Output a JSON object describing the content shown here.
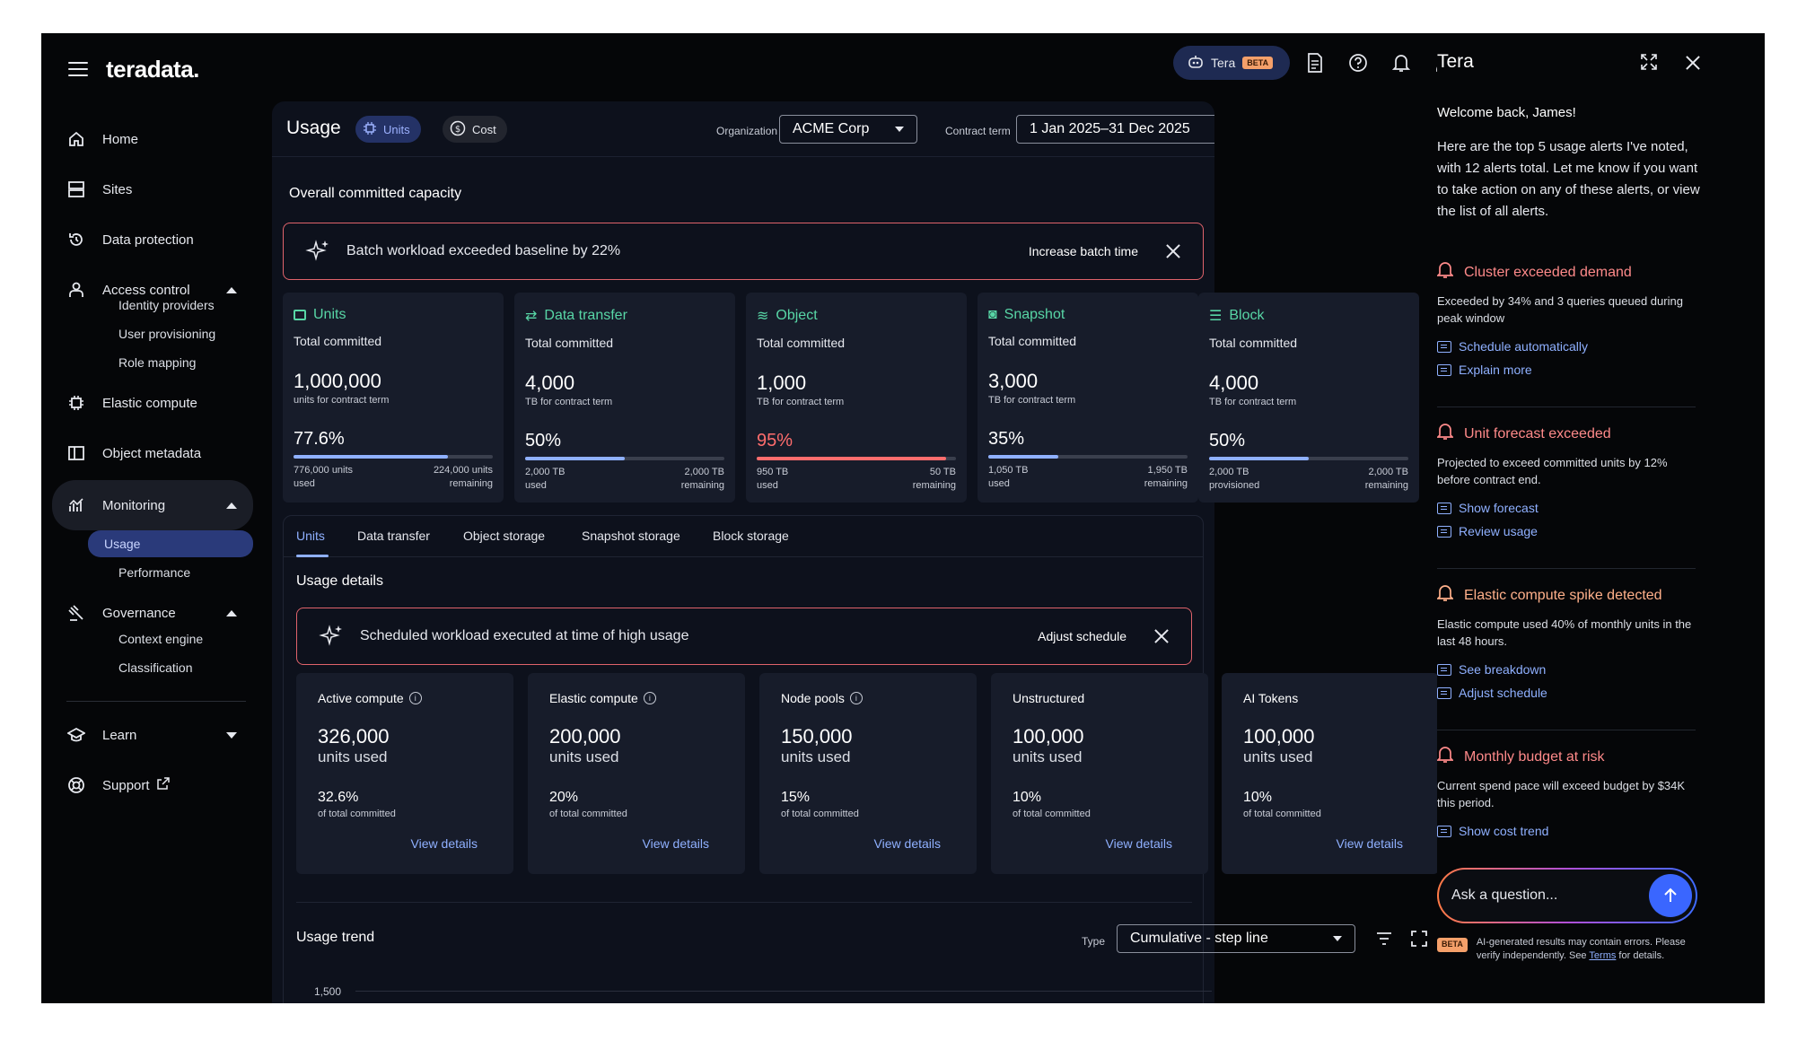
{
  "brand": {
    "logo": "teradata."
  },
  "sidebar": {
    "items": [
      {
        "id": "home",
        "label": "Home"
      },
      {
        "id": "sites",
        "label": "Sites"
      },
      {
        "id": "data-protection",
        "label": "Data protection"
      },
      {
        "id": "access-control",
        "label": "Access control"
      },
      {
        "id": "elastic-compute",
        "label": "Elastic compute"
      },
      {
        "id": "object-metadata",
        "label": "Object metadata"
      },
      {
        "id": "monitoring",
        "label": "Monitoring"
      },
      {
        "id": "governance",
        "label": "Governance"
      },
      {
        "id": "learn",
        "label": "Learn"
      },
      {
        "id": "support",
        "label": "Support"
      }
    ],
    "access_sub": [
      "Identity providers",
      "User provisioning",
      "Role mapping"
    ],
    "monitoring_sub": [
      "Usage",
      "Performance"
    ],
    "governance_sub": [
      "Context engine",
      "Classification"
    ]
  },
  "topbar": {
    "tera_label": "Tera",
    "beta_label": "BETA"
  },
  "header": {
    "title": "Usage",
    "units_label": "Units",
    "cost_label": "Cost",
    "org_label": "Organization",
    "org_value": "ACME Corp",
    "term_label": "Contract term",
    "term_value": "1 Jan 2025–31 Dec 2025"
  },
  "overall": {
    "title": "Overall committed capacity",
    "alert_msg": "Batch workload exceeded baseline by 22%",
    "alert_action": "Increase batch time"
  },
  "capacity_cards": [
    {
      "title": "Units",
      "tc": "Total committed",
      "big": "1,000,000",
      "small": "units for contract term",
      "pct": "77.6%",
      "fill": 0.776,
      "left1": "776,000 units",
      "left2": "used",
      "right1": "224,000 units",
      "right2": "remaining"
    },
    {
      "title": "Data transfer",
      "tc": "Total committed",
      "big": "4,000",
      "small": "TB for contract term",
      "pct": "50%",
      "fill": 0.5,
      "left1": "2,000 TB",
      "left2": "used",
      "right1": "2,000 TB",
      "right2": "remaining"
    },
    {
      "title": "Object",
      "tc": "Total committed",
      "big": "1,000",
      "small": "TB for contract term",
      "pct": "95%",
      "fill": 0.95,
      "left1": "950 TB",
      "left2": "used",
      "right1": "50 TB",
      "right2": "remaining"
    },
    {
      "title": "Snapshot",
      "tc": "Total committed",
      "big": "3,000",
      "small": "TB for contract term",
      "pct": "35%",
      "fill": 0.35,
      "left1": "1,050 TB",
      "left2": "used",
      "right1": "1,950 TB",
      "right2": "remaining"
    },
    {
      "title": "Block",
      "tc": "Total committed",
      "big": "4,000",
      "small": "TB for contract term",
      "pct": "50%",
      "fill": 0.5,
      "left1": "2,000 TB",
      "left2": "provisioned",
      "right1": "2,000 TB",
      "right2": "remaining"
    }
  ],
  "tabs": [
    "Units",
    "Data transfer",
    "Object storage",
    "Snapshot storage",
    "Block storage"
  ],
  "usage_details": {
    "title": "Usage details",
    "alert_msg": "Scheduled workload executed at time of high usage",
    "alert_action": "Adjust schedule",
    "cards": [
      {
        "title": "Active compute",
        "big": "326,000",
        "mid": "units used",
        "pct": "32.6%",
        "sm": "of total committed",
        "link": "View details"
      },
      {
        "title": "Elastic compute",
        "big": "200,000",
        "mid": "units used",
        "pct": "20%",
        "sm": "of total committed",
        "link": "View details"
      },
      {
        "title": "Node pools",
        "big": "150,000",
        "mid": "units used",
        "pct": "15%",
        "sm": "of total committed",
        "link": "View details"
      },
      {
        "title": "Unstructured",
        "big": "100,000",
        "mid": "units used",
        "pct": "10%",
        "sm": "of total committed",
        "link": "View details"
      },
      {
        "title": "AI Tokens",
        "big": "100,000",
        "mid": "units used",
        "pct": "10%",
        "sm": "of total committed",
        "link": "View details"
      }
    ]
  },
  "trend": {
    "title": "Usage trend",
    "type_label": "Type",
    "type_value": "Cumulative - step line",
    "y_tick": "1,500"
  },
  "tera": {
    "title": "Tera",
    "welcome": "Welcome back, James!",
    "intro": "Here are the top 5 usage alerts I've noted, with 12 alerts total. Let me know if you want to take action on any of these alerts, or view the list of all alerts.",
    "alerts": [
      {
        "title": "Cluster exceeded demand",
        "desc": "Exceeded by 34% and 3 queries queued during peak window",
        "links": [
          "Schedule automatically",
          "Explain more"
        ]
      },
      {
        "title": "Unit forecast exceeded",
        "desc": "Projected to exceed committed units by 12% before contract end.",
        "links": [
          "Show forecast",
          "Review usage"
        ]
      },
      {
        "title": "Elastic compute spike detected",
        "desc": "Elastic compute used 40% of monthly units in the last 48 hours.",
        "links": [
          "See breakdown",
          "Adjust schedule"
        ]
      },
      {
        "title": "Monthly budget at risk",
        "desc": "Current spend pace will exceed budget by $34K this period.",
        "links": [
          "Show cost trend"
        ]
      }
    ],
    "ask_placeholder": "Ask a question...",
    "beta_label": "BETA",
    "disclaimer_pre": "AI-generated results may contain errors. Please verify independently. See ",
    "disclaimer_link": "Terms",
    "disclaimer_post": " for details."
  }
}
